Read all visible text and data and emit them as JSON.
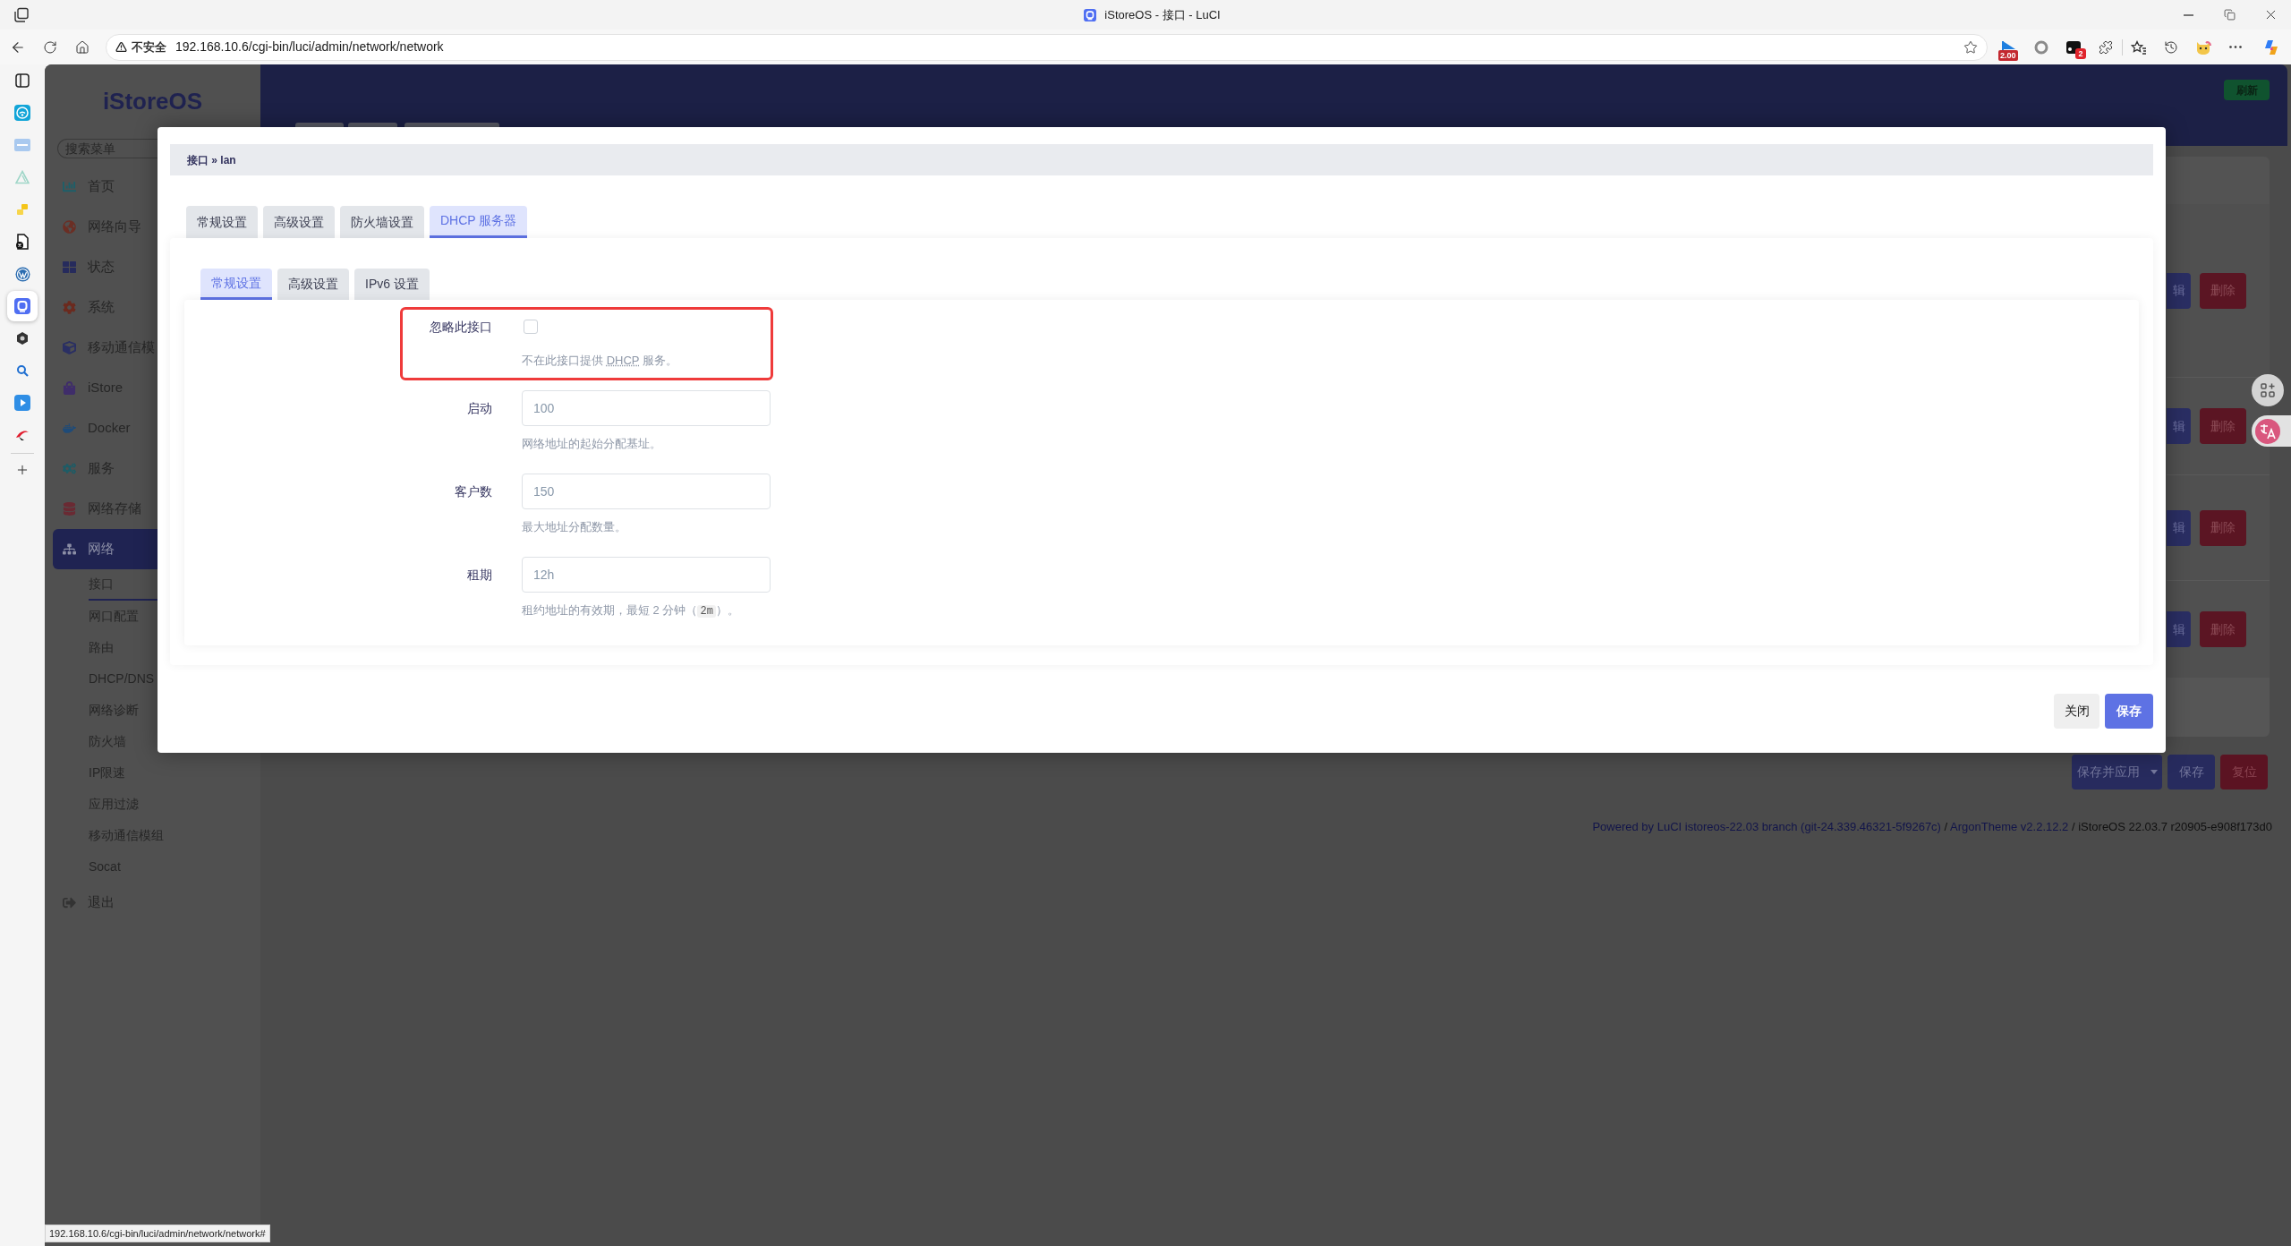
{
  "browser": {
    "title": "iStoreOS - 接口 - LuCI",
    "security_label": "不安全",
    "url": "192.168.10.6/cgi-bin/luci/admin/network/network",
    "badges": [
      "2.00",
      "2"
    ],
    "status_url": "192.168.10.6/cgi-bin/luci/admin/network/network#"
  },
  "sidebar_apps": [
    {
      "selected": false
    },
    {
      "selected": false
    },
    {
      "selected": false
    },
    {
      "selected": false
    },
    {
      "selected": false
    },
    {
      "selected": false
    },
    {
      "selected": false
    },
    {
      "selected": true
    },
    {
      "selected": false
    },
    {
      "selected": false
    },
    {
      "selected": false
    },
    {
      "selected": false
    }
  ],
  "luci": {
    "logo": "iStoreOS",
    "search": {
      "placeholder": "搜索菜单"
    },
    "menu": [
      {
        "label": "首页",
        "selected": false
      },
      {
        "label": "网络向导",
        "selected": false
      },
      {
        "label": "状态",
        "selected": false
      },
      {
        "label": "系统",
        "selected": false
      },
      {
        "label": "移动通信模",
        "selected": false
      },
      {
        "label": "iStore",
        "selected": false
      },
      {
        "label": "Docker",
        "selected": false
      },
      {
        "label": "服务",
        "selected": false
      },
      {
        "label": "网络存储",
        "selected": false
      },
      {
        "label": "网络",
        "selected": true,
        "children": [
          {
            "label": "接口",
            "selected": true
          },
          {
            "label": "网口配置",
            "selected": false
          },
          {
            "label": "路由",
            "selected": false
          },
          {
            "label": "DHCP/DNS",
            "selected": false
          },
          {
            "label": "网络诊断",
            "selected": false
          },
          {
            "label": "防火墙",
            "selected": false
          },
          {
            "label": "IP限速",
            "selected": false
          },
          {
            "label": "应用过滤",
            "selected": false
          },
          {
            "label": "移动通信模组",
            "selected": false
          },
          {
            "label": "Socat",
            "selected": false
          }
        ]
      },
      {
        "label": "退出",
        "selected": false
      }
    ],
    "refresh_button": "刷新",
    "interfaces": [
      {
        "edit": "辑",
        "delete": "删除"
      },
      {
        "edit": "辑",
        "delete": "删除"
      },
      {
        "edit": "辑",
        "delete": "删除"
      },
      {
        "edit": "辑",
        "delete": "删除"
      }
    ],
    "actions": [
      {
        "label": "保存并应用",
        "kind": "dropdown"
      },
      {
        "label": "保存",
        "kind": "primary"
      },
      {
        "label": "复位",
        "kind": "danger"
      }
    ],
    "footer": [
      {
        "text": "Powered by LuCI istoreos-22.03 branch (git-24.339.46321-5f9267c)",
        "link": true
      },
      {
        "text": " / ",
        "link": false
      },
      {
        "text": "ArgonTheme v2.2.12.2",
        "link": true
      },
      {
        "text": " / iStoreOS 22.03.7 r20905-e908f173d0",
        "link": false
      }
    ]
  },
  "dialog": {
    "breadcrumb": "接口 » lan",
    "tabs": [
      {
        "label": "常规设置",
        "selected": false
      },
      {
        "label": "高级设置",
        "selected": false
      },
      {
        "label": "防火墙设置",
        "selected": false
      },
      {
        "label": "DHCP 服务器",
        "selected": true
      }
    ],
    "subtabs": [
      {
        "label": "常规设置",
        "selected": true
      },
      {
        "label": "高级设置",
        "selected": false
      },
      {
        "label": "IPv6 设置",
        "selected": false
      }
    ],
    "fields": [
      {
        "kind": "checkbox",
        "label": "忽略此接口",
        "checked": false,
        "highlighted": true,
        "description": [
          {
            "text": "不在此接口提供 ",
            "kind": "plain"
          },
          {
            "text": "DHCP",
            "kind": "abbr"
          },
          {
            "text": " 服务。",
            "kind": "plain"
          }
        ]
      },
      {
        "kind": "text",
        "label": "启动",
        "value": "100",
        "highlighted": false,
        "description": [
          {
            "text": "网络地址的起始分配基址。",
            "kind": "plain"
          }
        ]
      },
      {
        "kind": "text",
        "label": "客户数",
        "value": "150",
        "highlighted": false,
        "description": [
          {
            "text": "最大地址分配数量。",
            "kind": "plain"
          }
        ]
      },
      {
        "kind": "text",
        "label": "租期",
        "value": "12h",
        "highlighted": false,
        "description": [
          {
            "text": "租约地址的有效期，最短 2 分钟（",
            "kind": "plain"
          },
          {
            "text": "2m",
            "kind": "code"
          },
          {
            "text": "）。",
            "kind": "plain"
          }
        ]
      }
    ],
    "buttons": [
      {
        "label": "关闭",
        "kind": "secondary"
      },
      {
        "label": "保存",
        "kind": "primary"
      }
    ]
  }
}
